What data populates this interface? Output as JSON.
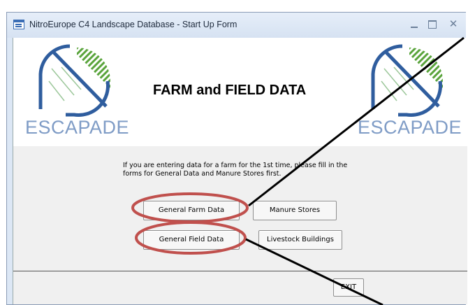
{
  "window": {
    "title": "NitroEurope C4 Landscape Database - Start Up Form",
    "controls": [
      "minimize",
      "maximize",
      "close"
    ]
  },
  "header": {
    "heading": "FARM and FIELD DATA",
    "logo_text": "ESCAPADE"
  },
  "detail": {
    "instructions": "If you are entering data for a farm for the 1st time, please fill in the forms for General Data and Manure Stores first.",
    "buttons": {
      "general_farm": "General Farm Data",
      "manure_stores": "Manure Stores",
      "general_field": "General Field Data",
      "livestock_buildings": "Livestock Buildings"
    }
  },
  "footer": {
    "exit_label": "EXIT"
  },
  "colors": {
    "highlight_ellipse": "#c0504d",
    "logo_green": "#5aa43c",
    "logo_blue": "#2f5d9e"
  }
}
